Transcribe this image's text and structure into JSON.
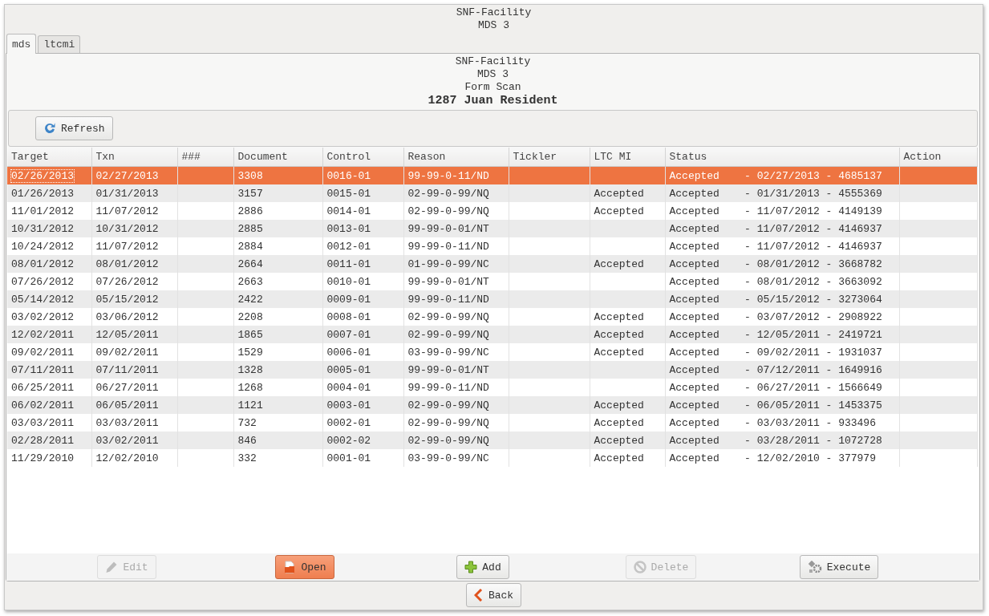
{
  "window": {
    "title_lines": [
      "SNF-Facility",
      "MDS 3"
    ]
  },
  "tabs": [
    {
      "label": "mds",
      "selected": true
    },
    {
      "label": "ltcmi",
      "selected": false
    }
  ],
  "panel": {
    "lines": [
      "SNF-Facility",
      "MDS 3",
      "Form Scan"
    ],
    "resident": "1287  Juan Resident"
  },
  "toolbar": {
    "refresh": "Refresh"
  },
  "table": {
    "columns": [
      "Target",
      "Txn",
      "###",
      "Document",
      "Control",
      "Reason",
      "Tickler",
      "LTC MI",
      "Status",
      "Action"
    ],
    "rows": [
      {
        "selected": true,
        "cells": [
          "02/26/2013",
          "02/27/2013",
          "",
          "3308",
          "0016-01",
          "99-99-0-11/ND",
          "",
          "",
          "Accepted    - 02/27/2013 - 4685137",
          ""
        ]
      },
      {
        "selected": false,
        "cells": [
          "01/26/2013",
          "01/31/2013",
          "",
          "3157",
          "0015-01",
          "02-99-0-99/NQ",
          "",
          "Accepted",
          "Accepted    - 01/31/2013 - 4555369",
          ""
        ]
      },
      {
        "selected": false,
        "cells": [
          "11/01/2012",
          "11/07/2012",
          "",
          "2886",
          "0014-01",
          "02-99-0-99/NQ",
          "",
          "Accepted",
          "Accepted    - 11/07/2012 - 4149139",
          ""
        ]
      },
      {
        "selected": false,
        "cells": [
          "10/31/2012",
          "10/31/2012",
          "",
          "2885",
          "0013-01",
          "99-99-0-01/NT",
          "",
          "",
          "Accepted    - 11/07/2012 - 4146937",
          ""
        ]
      },
      {
        "selected": false,
        "cells": [
          "10/24/2012",
          "11/07/2012",
          "",
          "2884",
          "0012-01",
          "99-99-0-11/ND",
          "",
          "",
          "Accepted    - 11/07/2012 - 4146937",
          ""
        ]
      },
      {
        "selected": false,
        "cells": [
          "08/01/2012",
          "08/01/2012",
          "",
          "2664",
          "0011-01",
          "01-99-0-99/NC",
          "",
          "Accepted",
          "Accepted    - 08/01/2012 - 3668782",
          ""
        ]
      },
      {
        "selected": false,
        "cells": [
          "07/26/2012",
          "07/26/2012",
          "",
          "2663",
          "0010-01",
          "99-99-0-01/NT",
          "",
          "",
          "Accepted    - 08/01/2012 - 3663092",
          ""
        ]
      },
      {
        "selected": false,
        "cells": [
          "05/14/2012",
          "05/15/2012",
          "",
          "2422",
          "0009-01",
          "99-99-0-11/ND",
          "",
          "",
          "Accepted    - 05/15/2012 - 3273064",
          ""
        ]
      },
      {
        "selected": false,
        "cells": [
          "03/02/2012",
          "03/06/2012",
          "",
          "2208",
          "0008-01",
          "02-99-0-99/NQ",
          "",
          "Accepted",
          "Accepted    - 03/07/2012 - 2908922",
          ""
        ]
      },
      {
        "selected": false,
        "cells": [
          "12/02/2011",
          "12/05/2011",
          "",
          "1865",
          "0007-01",
          "02-99-0-99/NQ",
          "",
          "Accepted",
          "Accepted    - 12/05/2011 - 2419721",
          ""
        ]
      },
      {
        "selected": false,
        "cells": [
          "09/02/2011",
          "09/02/2011",
          "",
          "1529",
          "0006-01",
          "03-99-0-99/NC",
          "",
          "Accepted",
          "Accepted    - 09/02/2011 - 1931037",
          ""
        ]
      },
      {
        "selected": false,
        "cells": [
          "07/11/2011",
          "07/11/2011",
          "",
          "1328",
          "0005-01",
          "99-99-0-01/NT",
          "",
          "",
          "Accepted    - 07/12/2011 - 1649916",
          ""
        ]
      },
      {
        "selected": false,
        "cells": [
          "06/25/2011",
          "06/27/2011",
          "",
          "1268",
          "0004-01",
          "99-99-0-11/ND",
          "",
          "",
          "Accepted    - 06/27/2011 - 1566649",
          ""
        ]
      },
      {
        "selected": false,
        "cells": [
          "06/02/2011",
          "06/05/2011",
          "",
          "1121",
          "0003-01",
          "02-99-0-99/NQ",
          "",
          "Accepted",
          "Accepted    - 06/05/2011 - 1453375",
          ""
        ]
      },
      {
        "selected": false,
        "cells": [
          "03/03/2011",
          "03/03/2011",
          "",
          "732",
          "0002-01",
          "02-99-0-99/NQ",
          "",
          "Accepted",
          "Accepted    - 03/03/2011 - 933496",
          ""
        ]
      },
      {
        "selected": false,
        "cells": [
          "02/28/2011",
          "03/02/2011",
          "",
          "846",
          "0002-02",
          "02-99-0-99/NQ",
          "",
          "Accepted",
          "Accepted    - 03/28/2011 - 1072728",
          ""
        ]
      },
      {
        "selected": false,
        "cells": [
          "11/29/2010",
          "12/02/2010",
          "",
          "332",
          "0001-01",
          "03-99-0-99/NC",
          "",
          "Accepted",
          "Accepted    - 12/02/2010 - 377979",
          ""
        ]
      }
    ]
  },
  "buttons": [
    {
      "kind": "edit",
      "label": "Edit",
      "disabled": true,
      "default": false
    },
    {
      "kind": "open",
      "label": "Open",
      "disabled": false,
      "default": true
    },
    {
      "kind": "add",
      "label": "Add",
      "disabled": false,
      "default": false
    },
    {
      "kind": "delete",
      "label": "Delete",
      "disabled": true,
      "default": false
    },
    {
      "kind": "execute",
      "label": "Execute",
      "disabled": false,
      "default": false
    }
  ],
  "back": "Back"
}
